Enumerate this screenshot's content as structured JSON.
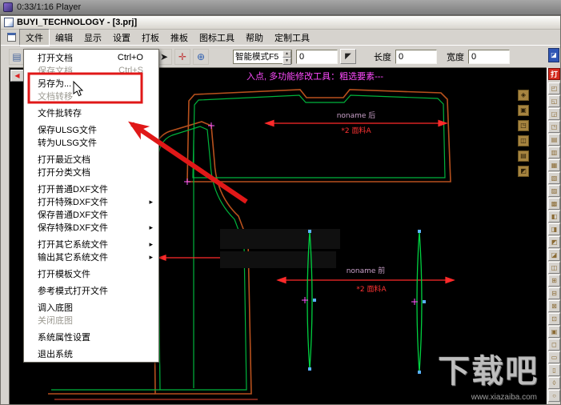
{
  "player_bar": {
    "title": "0:33/1:16 Player"
  },
  "window": {
    "title": "BUYI_TECHNOLOGY - [3.prj]",
    "menu_bar": [
      "文件",
      "编辑",
      "显示",
      "设置",
      "打板",
      "推板",
      "图标工具",
      "帮助",
      "定制工具"
    ]
  },
  "toolbar": {
    "icons": [
      {
        "name": "new-file-icon",
        "glyph": "▤",
        "color": "#44639c"
      },
      {
        "name": "pattern-tool-icon-1",
        "glyph": "✚",
        "color": "#c03a3a"
      },
      {
        "name": "pattern-tool-icon-2",
        "glyph": "⊞",
        "color": "#b9541e"
      },
      {
        "name": "pattern-tool-icon-3",
        "glyph": "✎",
        "color": "#7a4aa0"
      },
      {
        "name": "pattern-tool-icon-4",
        "glyph": "▦",
        "color": "#2f7a3a"
      },
      {
        "name": "pattern-tool-icon-5",
        "glyph": "✛",
        "color": "#c03a3a"
      },
      {
        "name": "pattern-tool-icon-6",
        "glyph": "◧",
        "color": "#44639c"
      },
      {
        "name": "pattern-tool-icon-7",
        "glyph": "⌁",
        "color": "#b9541e"
      },
      {
        "name": "select-pointer-icon",
        "glyph": "➤",
        "color": "#1a1a1a"
      },
      {
        "name": "point-edit-icon",
        "glyph": "✛",
        "color": "#c03a3a"
      },
      {
        "name": "refresh-icon",
        "glyph": "⊕",
        "color": "#2f5fb0"
      }
    ],
    "mode_select_value": "智能模式F5",
    "input_value": "0",
    "pick_button_glyph": "◤",
    "length_label": "长度",
    "length_value": "0",
    "width_label": "宽度",
    "width_value": "0"
  },
  "file_menu": {
    "items": [
      {
        "label": "打开文档",
        "shortcut": "Ctrl+O"
      },
      {
        "label": "保存文档",
        "shortcut": "Ctrl+S",
        "enabled": false
      },
      {
        "label": "另存为..."
      },
      {
        "label": "文档转移",
        "enabled": false
      },
      {
        "sep": true
      },
      {
        "label": "文件批转存"
      },
      {
        "sep": true
      },
      {
        "label": "保存ULSG文件"
      },
      {
        "label": "转为ULSG文件"
      },
      {
        "sep": true
      },
      {
        "label": "打开最近文档"
      },
      {
        "label": "打开分类文档"
      },
      {
        "sep": true
      },
      {
        "label": "打开普通DXF文件"
      },
      {
        "label": "打开特殊DXF文件",
        "submenu": true
      },
      {
        "label": "保存普通DXF文件"
      },
      {
        "label": "保存特殊DXF文件",
        "submenu": true
      },
      {
        "sep": true
      },
      {
        "label": "打开其它系统文件",
        "submenu": true
      },
      {
        "label": "输出其它系统文件",
        "submenu": true
      },
      {
        "sep": true
      },
      {
        "label": "打开模板文件"
      },
      {
        "sep": true
      },
      {
        "label": "参考模式打开文件"
      },
      {
        "sep": true
      },
      {
        "label": "调入底图"
      },
      {
        "label": "关闭底图",
        "enabled": false
      },
      {
        "sep": true
      },
      {
        "label": "系统属性设置"
      },
      {
        "sep": true
      },
      {
        "label": "退出系统"
      }
    ]
  },
  "canvas": {
    "prompt": "入点, 多功能修改工具：粗选要素---",
    "back_button_glyph": "◀",
    "pieces": [
      {
        "name_label": "noname 后",
        "fabric_label": "*2 面料A"
      },
      {
        "name_label": "noname 前",
        "fabric_label": "*2 面料A"
      }
    ],
    "side_tools": [
      "◈",
      "▣",
      "◳",
      "◫",
      "▤",
      "◩"
    ],
    "colors": {
      "background": "#000000",
      "outline": "#b8511d",
      "inner_line": "#00b43c",
      "dimension": "#ff2a2a",
      "marker": "#ff5aff",
      "handle": "#5ab0ff",
      "prompt": "#ff4bff"
    }
  },
  "right_toolbar": {
    "top_button": "打",
    "buttons": [
      "◰",
      "◱",
      "◲",
      "◳",
      "▤",
      "▥",
      "▦",
      "▧",
      "▨",
      "▩",
      "◧",
      "◨",
      "◩",
      "◪",
      "◫",
      "⊞",
      "⊟",
      "⊠",
      "⊡",
      "▣",
      "◻",
      "▭",
      "▯",
      "◊",
      "○"
    ]
  },
  "annotation": {
    "color": "#e01818"
  },
  "watermark": {
    "text": "下载吧",
    "url": "www.xiazaiba.com"
  }
}
